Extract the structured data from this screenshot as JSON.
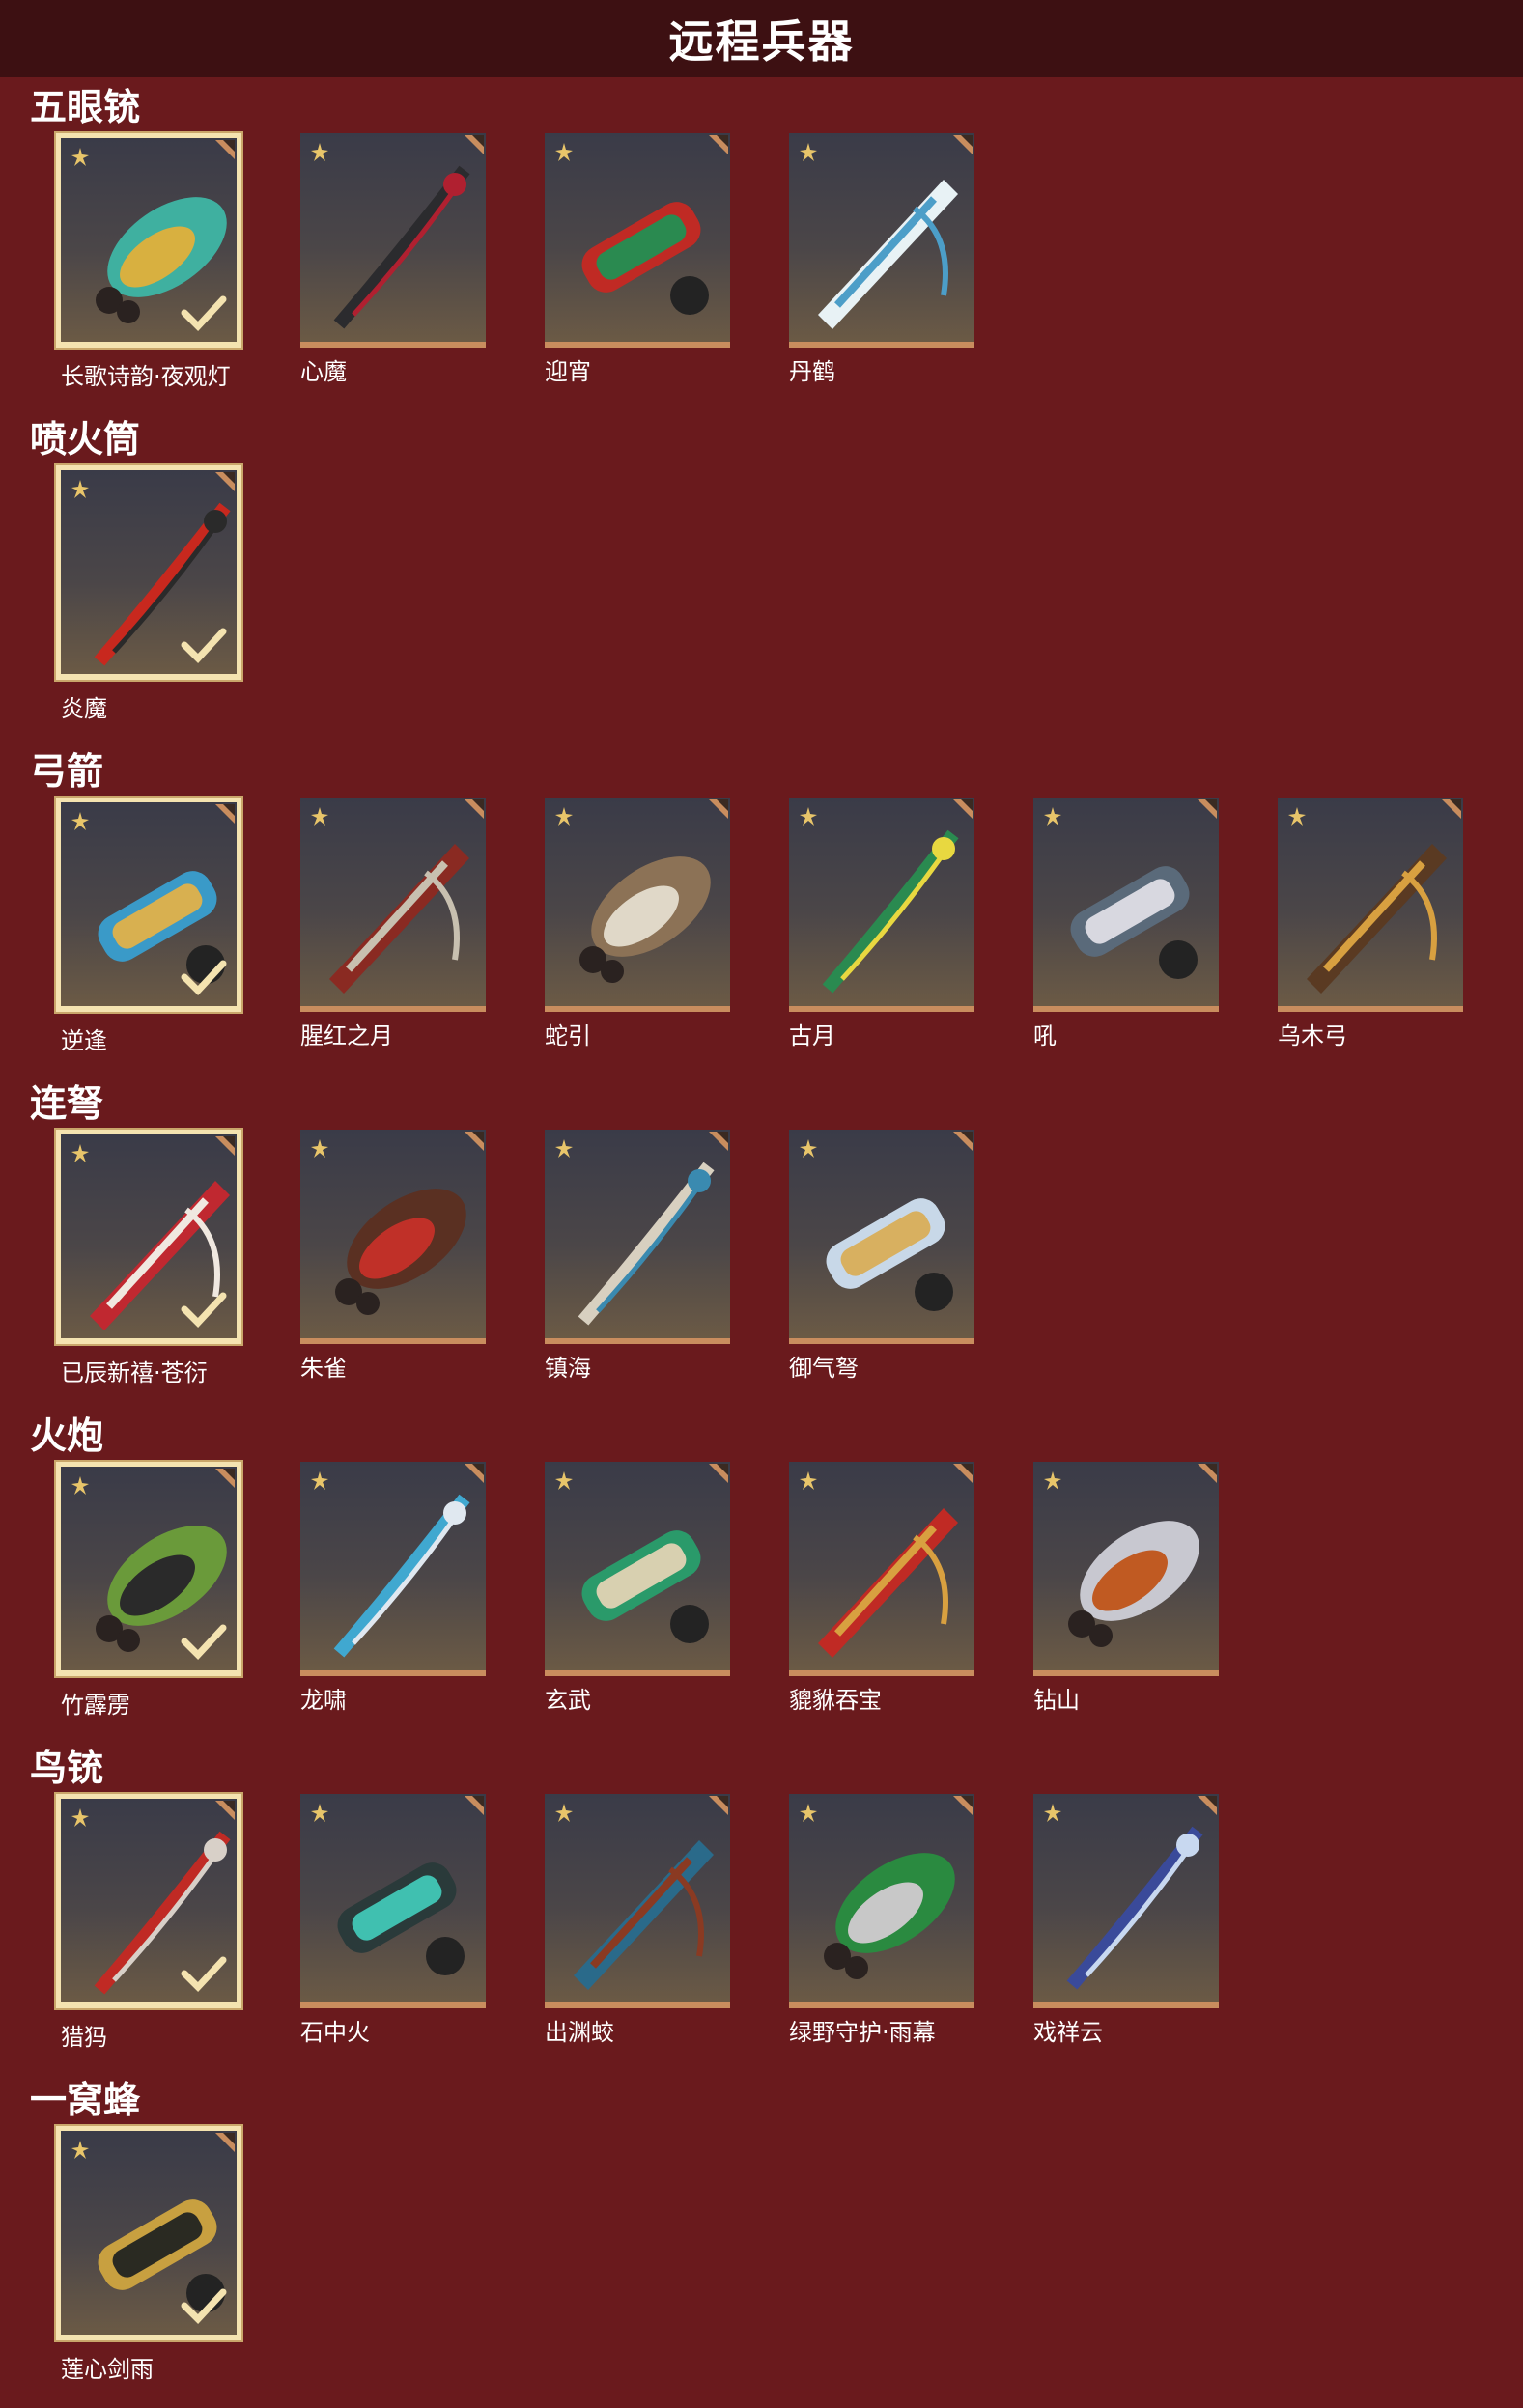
{
  "header": {
    "title": "远程兵器"
  },
  "colors": {
    "background": "#6a1a1d",
    "header": "#3d1012",
    "selected_border": "#f4e3b0",
    "card_bottom": "#c98d5e"
  },
  "sections": [
    {
      "title": "五眼铳",
      "items": [
        {
          "name": "长歌诗韵·夜观灯",
          "selected": true,
          "palette": [
            "#3fb0a0",
            "#d8b040"
          ]
        },
        {
          "name": "心魔",
          "selected": false,
          "palette": [
            "#2b2b2e",
            "#b02030"
          ]
        },
        {
          "name": "迎宵",
          "selected": false,
          "palette": [
            "#c02a24",
            "#2a8a50"
          ]
        },
        {
          "name": "丹鹤",
          "selected": false,
          "palette": [
            "#e8f2f5",
            "#4c9ec8"
          ]
        }
      ]
    },
    {
      "title": "喷火筒",
      "items": [
        {
          "name": "炎魔",
          "selected": true,
          "palette": [
            "#c8281e",
            "#2a2a2a"
          ]
        }
      ]
    },
    {
      "title": "弓箭",
      "items": [
        {
          "name": "逆逢",
          "selected": true,
          "palette": [
            "#3a9ac8",
            "#d8b050"
          ]
        },
        {
          "name": "腥红之月",
          "selected": false,
          "palette": [
            "#8a2a22",
            "#c8c0b0"
          ]
        },
        {
          "name": "蛇引",
          "selected": false,
          "palette": [
            "#8c7256",
            "#e0d8c8"
          ]
        },
        {
          "name": "古月",
          "selected": false,
          "palette": [
            "#2a8a50",
            "#e8d840"
          ]
        },
        {
          "name": "吼",
          "selected": false,
          "palette": [
            "#5a6a7a",
            "#d8d8e0"
          ]
        },
        {
          "name": "乌木弓",
          "selected": false,
          "palette": [
            "#5a3a22",
            "#d8a040"
          ]
        }
      ]
    },
    {
      "title": "连弩",
      "items": [
        {
          "name": "已辰新禧·苍衍",
          "selected": true,
          "palette": [
            "#c02830",
            "#f0e8e0"
          ]
        },
        {
          "name": "朱雀",
          "selected": false,
          "palette": [
            "#5a3022",
            "#c03028"
          ]
        },
        {
          "name": "镇海",
          "selected": false,
          "palette": [
            "#d8d0c0",
            "#3a8ab0"
          ]
        },
        {
          "name": "御气弩",
          "selected": false,
          "palette": [
            "#c8d8e8",
            "#d8b060"
          ]
        }
      ]
    },
    {
      "title": "火炮",
      "items": [
        {
          "name": "竹霹雳",
          "selected": true,
          "palette": [
            "#6a9a3a",
            "#2a2a2a"
          ]
        },
        {
          "name": "龙啸",
          "selected": false,
          "palette": [
            "#40a8d0",
            "#e0e8f0"
          ]
        },
        {
          "name": "玄武",
          "selected": false,
          "palette": [
            "#2a9a6a",
            "#d8d0b0"
          ]
        },
        {
          "name": "貔貅吞宝",
          "selected": false,
          "palette": [
            "#c02a24",
            "#d8a040"
          ]
        },
        {
          "name": "钻山",
          "selected": false,
          "palette": [
            "#c8c8d0",
            "#c05a22"
          ]
        }
      ]
    },
    {
      "title": "鸟铳",
      "items": [
        {
          "name": "猎犸",
          "selected": true,
          "palette": [
            "#c02a24",
            "#d8d0c8"
          ]
        },
        {
          "name": "石中火",
          "selected": false,
          "palette": [
            "#2a3a3a",
            "#40c0b0"
          ]
        },
        {
          "name": "出渊蛟",
          "selected": false,
          "palette": [
            "#2a6a8a",
            "#8a3a22"
          ]
        },
        {
          "name": "绿野守护·雨幕",
          "selected": false,
          "palette": [
            "#2a8a40",
            "#c8c8c8"
          ]
        },
        {
          "name": "戏祥云",
          "selected": false,
          "palette": [
            "#3a4a9a",
            "#c8d8f0"
          ]
        }
      ]
    },
    {
      "title": "一窝蜂",
      "items": [
        {
          "name": "莲心剑雨",
          "selected": true,
          "palette": [
            "#c8a040",
            "#2a2a22"
          ]
        }
      ]
    }
  ]
}
